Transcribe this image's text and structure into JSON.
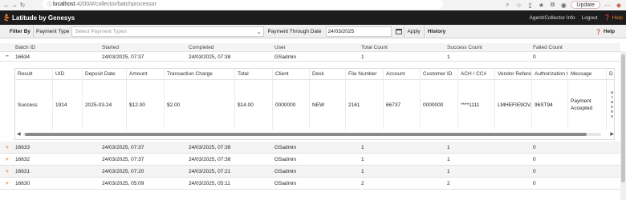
{
  "browser": {
    "url_host": "localhost",
    "url_path": ":4200/#/collector/batchprocessor",
    "update_label": "Update"
  },
  "app": {
    "title": "Latitude by Genesys",
    "header_links": [
      "Agent/Collector Info",
      "Logout"
    ],
    "help_label": "Help"
  },
  "filter": {
    "filter_by": "Filter By",
    "payment_type_label": "Payment Type",
    "payment_type_placeholder": "Select Payment Types",
    "through_date_label": "Payment Through Date",
    "through_date_value": "24/03/2025",
    "apply_label": "Apply",
    "history_label": "History",
    "help_label": "Help"
  },
  "grid": {
    "columns": [
      "Batch ID",
      "Started",
      "Completed",
      "User",
      "Total Count",
      "Success Count",
      "Failed Count"
    ],
    "rows": [
      {
        "batch_id": "16634",
        "started": "24/03/2025, 07:37",
        "completed": "24/03/2025, 07:38",
        "user": "GSadmin",
        "total": "1",
        "success": "1",
        "failed": "0",
        "expanded": true
      },
      {
        "batch_id": "16633",
        "started": "24/03/2025, 07:37",
        "completed": "24/03/2025, 07:38",
        "user": "GSadmin",
        "total": "1",
        "success": "1",
        "failed": "0",
        "expanded": false
      },
      {
        "batch_id": "16632",
        "started": "24/03/2025, 07:37",
        "completed": "24/03/2025, 07:38",
        "user": "GSadmin",
        "total": "1",
        "success": "1",
        "failed": "0",
        "expanded": false
      },
      {
        "batch_id": "16631",
        "started": "24/03/2025, 07:20",
        "completed": "24/03/2025, 07:21",
        "user": "GSadmin",
        "total": "1",
        "success": "1",
        "failed": "0",
        "expanded": false
      },
      {
        "batch_id": "16630",
        "started": "24/03/2025, 05:09",
        "completed": "24/03/2025, 05:11",
        "user": "GSadmin",
        "total": "2",
        "success": "2",
        "failed": "0",
        "expanded": false
      }
    ]
  },
  "detail": {
    "columns": [
      "Result",
      "UID",
      "Deposit Date",
      "Amount",
      "Transaction Charge",
      "Total",
      "Client",
      "Desk",
      "File Number",
      "Account",
      "Customer ID",
      "ACH / CC#",
      "Vendor Referen...",
      "Authorization C...",
      "Message",
      "D"
    ],
    "row": [
      "Success",
      "1914",
      "2025-03-24",
      "$12.00",
      "$2.00",
      "$14.00",
      "0000000",
      "NEW",
      "2161",
      "66737",
      "0000000",
      "****1111",
      "LMHEFIE9OV...",
      "96ST94",
      "Payment Accepted",
      ""
    ],
    "side_letters": [
      "a",
      "r",
      "a",
      "s",
      "e",
      "o"
    ]
  },
  "colors": {
    "header_bg": "#1c1c1c",
    "accent": "#d07a1e"
  }
}
